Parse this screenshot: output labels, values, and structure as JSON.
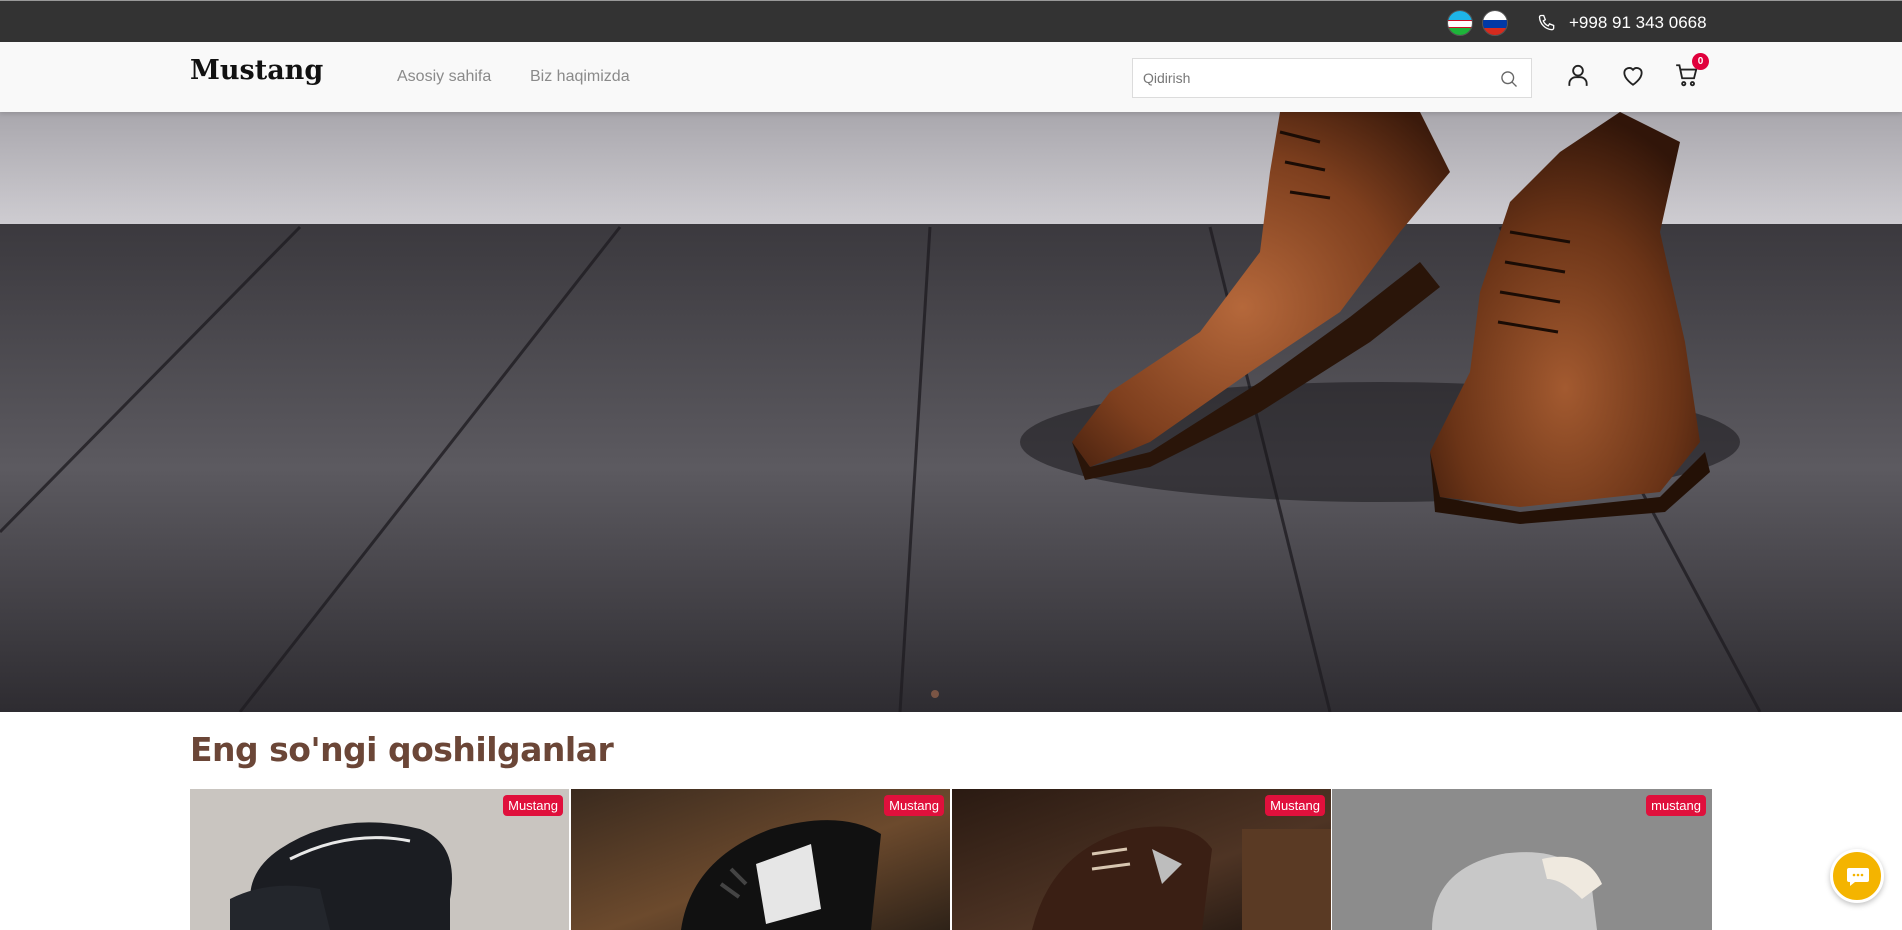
{
  "topbar": {
    "flags": [
      {
        "icon": "uzbekistan-flag-icon",
        "colors": [
          "#1eb5e8",
          "#ffffff",
          "#1eb53a"
        ]
      },
      {
        "icon": "russia-flag-icon",
        "colors": [
          "#ffffff",
          "#0039a6",
          "#d52b1e"
        ]
      }
    ],
    "phone_icon": "phone-icon",
    "phone": "+998 91 343 0668"
  },
  "header": {
    "logo": "Mustang",
    "nav": [
      {
        "label": "Asosiy sahifa"
      },
      {
        "label": "Biz haqimizda"
      }
    ],
    "search": {
      "placeholder": "Qidirish",
      "value": "",
      "icon": "search-icon"
    },
    "icons": [
      "user-icon",
      "heart-icon",
      "cart-icon"
    ],
    "cart_count": "0"
  },
  "hero": {
    "slides_total": 1,
    "active_slide": 1
  },
  "section": {
    "title": "Eng so'ngi qoshilganlar"
  },
  "products": [
    {
      "brand": "Mustang"
    },
    {
      "brand": "Mustang"
    },
    {
      "brand": "Mustang"
    },
    {
      "brand": "mustang"
    }
  ],
  "chat": {
    "icon": "chat-icon"
  },
  "colors": {
    "topbar_bg": "#333333",
    "accent_red": "#e0103c",
    "section_title": "#6b4637",
    "chat_button": "#f4b400"
  }
}
